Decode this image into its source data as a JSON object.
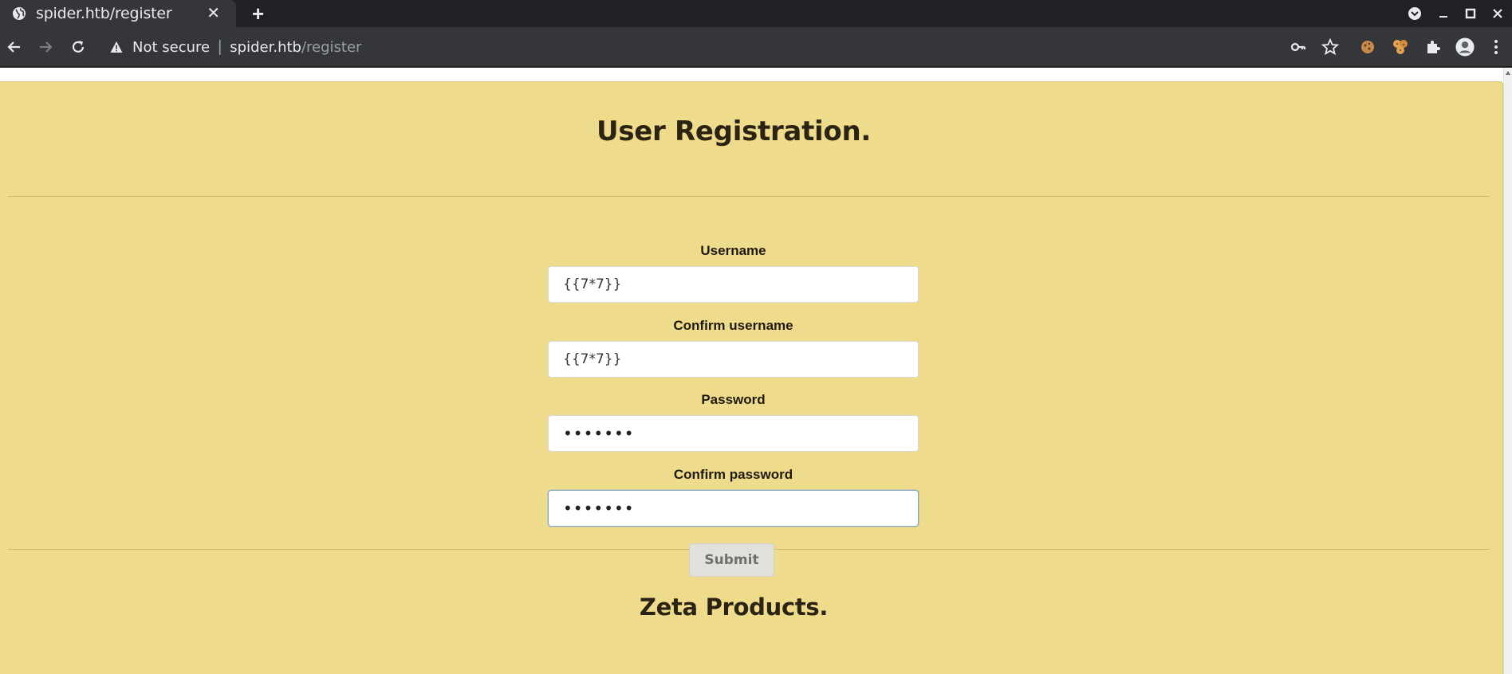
{
  "browser": {
    "tab_title": "spider.htb/register",
    "security_label": "Not secure",
    "url_host": "spider.htb",
    "url_path": "/register"
  },
  "page": {
    "title": "User Registration.",
    "footer_title": "Zeta Products.",
    "background_color": "#eedb8b"
  },
  "form": {
    "username_label": "Username",
    "username_value": "{{7*7}}",
    "confirm_username_label": "Confirm username",
    "confirm_username_value": "{{7*7}}",
    "password_label": "Password",
    "password_value": "•••••••",
    "confirm_password_label": "Confirm password",
    "confirm_password_value": "•••••••",
    "submit_label": "Submit"
  }
}
